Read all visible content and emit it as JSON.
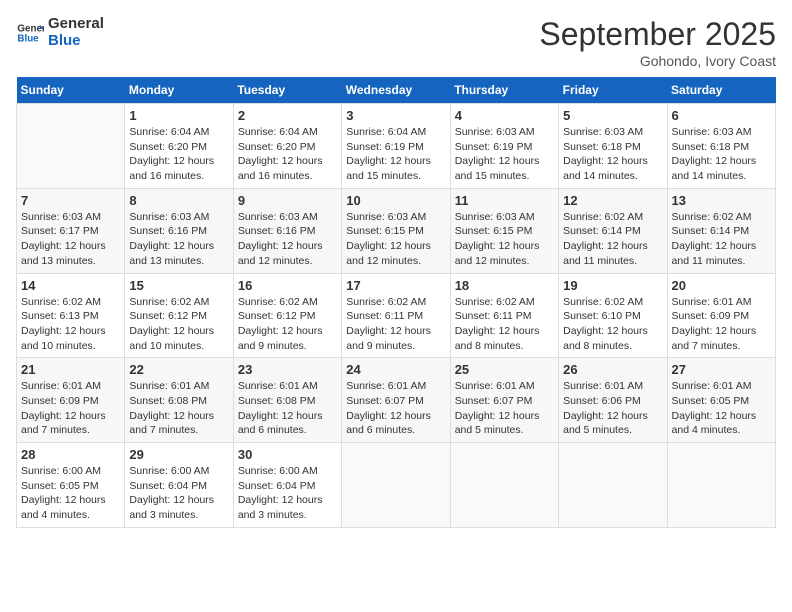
{
  "header": {
    "logo_line1": "General",
    "logo_line2": "Blue",
    "month": "September 2025",
    "location": "Gohondo, Ivory Coast"
  },
  "days_of_week": [
    "Sunday",
    "Monday",
    "Tuesday",
    "Wednesday",
    "Thursday",
    "Friday",
    "Saturday"
  ],
  "weeks": [
    [
      {
        "num": "",
        "info": ""
      },
      {
        "num": "1",
        "info": "Sunrise: 6:04 AM\nSunset: 6:20 PM\nDaylight: 12 hours\nand 16 minutes."
      },
      {
        "num": "2",
        "info": "Sunrise: 6:04 AM\nSunset: 6:20 PM\nDaylight: 12 hours\nand 16 minutes."
      },
      {
        "num": "3",
        "info": "Sunrise: 6:04 AM\nSunset: 6:19 PM\nDaylight: 12 hours\nand 15 minutes."
      },
      {
        "num": "4",
        "info": "Sunrise: 6:03 AM\nSunset: 6:19 PM\nDaylight: 12 hours\nand 15 minutes."
      },
      {
        "num": "5",
        "info": "Sunrise: 6:03 AM\nSunset: 6:18 PM\nDaylight: 12 hours\nand 14 minutes."
      },
      {
        "num": "6",
        "info": "Sunrise: 6:03 AM\nSunset: 6:18 PM\nDaylight: 12 hours\nand 14 minutes."
      }
    ],
    [
      {
        "num": "7",
        "info": "Sunrise: 6:03 AM\nSunset: 6:17 PM\nDaylight: 12 hours\nand 13 minutes."
      },
      {
        "num": "8",
        "info": "Sunrise: 6:03 AM\nSunset: 6:16 PM\nDaylight: 12 hours\nand 13 minutes."
      },
      {
        "num": "9",
        "info": "Sunrise: 6:03 AM\nSunset: 6:16 PM\nDaylight: 12 hours\nand 12 minutes."
      },
      {
        "num": "10",
        "info": "Sunrise: 6:03 AM\nSunset: 6:15 PM\nDaylight: 12 hours\nand 12 minutes."
      },
      {
        "num": "11",
        "info": "Sunrise: 6:03 AM\nSunset: 6:15 PM\nDaylight: 12 hours\nand 12 minutes."
      },
      {
        "num": "12",
        "info": "Sunrise: 6:02 AM\nSunset: 6:14 PM\nDaylight: 12 hours\nand 11 minutes."
      },
      {
        "num": "13",
        "info": "Sunrise: 6:02 AM\nSunset: 6:14 PM\nDaylight: 12 hours\nand 11 minutes."
      }
    ],
    [
      {
        "num": "14",
        "info": "Sunrise: 6:02 AM\nSunset: 6:13 PM\nDaylight: 12 hours\nand 10 minutes."
      },
      {
        "num": "15",
        "info": "Sunrise: 6:02 AM\nSunset: 6:12 PM\nDaylight: 12 hours\nand 10 minutes."
      },
      {
        "num": "16",
        "info": "Sunrise: 6:02 AM\nSunset: 6:12 PM\nDaylight: 12 hours\nand 9 minutes."
      },
      {
        "num": "17",
        "info": "Sunrise: 6:02 AM\nSunset: 6:11 PM\nDaylight: 12 hours\nand 9 minutes."
      },
      {
        "num": "18",
        "info": "Sunrise: 6:02 AM\nSunset: 6:11 PM\nDaylight: 12 hours\nand 8 minutes."
      },
      {
        "num": "19",
        "info": "Sunrise: 6:02 AM\nSunset: 6:10 PM\nDaylight: 12 hours\nand 8 minutes."
      },
      {
        "num": "20",
        "info": "Sunrise: 6:01 AM\nSunset: 6:09 PM\nDaylight: 12 hours\nand 7 minutes."
      }
    ],
    [
      {
        "num": "21",
        "info": "Sunrise: 6:01 AM\nSunset: 6:09 PM\nDaylight: 12 hours\nand 7 minutes."
      },
      {
        "num": "22",
        "info": "Sunrise: 6:01 AM\nSunset: 6:08 PM\nDaylight: 12 hours\nand 7 minutes."
      },
      {
        "num": "23",
        "info": "Sunrise: 6:01 AM\nSunset: 6:08 PM\nDaylight: 12 hours\nand 6 minutes."
      },
      {
        "num": "24",
        "info": "Sunrise: 6:01 AM\nSunset: 6:07 PM\nDaylight: 12 hours\nand 6 minutes."
      },
      {
        "num": "25",
        "info": "Sunrise: 6:01 AM\nSunset: 6:07 PM\nDaylight: 12 hours\nand 5 minutes."
      },
      {
        "num": "26",
        "info": "Sunrise: 6:01 AM\nSunset: 6:06 PM\nDaylight: 12 hours\nand 5 minutes."
      },
      {
        "num": "27",
        "info": "Sunrise: 6:01 AM\nSunset: 6:05 PM\nDaylight: 12 hours\nand 4 minutes."
      }
    ],
    [
      {
        "num": "28",
        "info": "Sunrise: 6:00 AM\nSunset: 6:05 PM\nDaylight: 12 hours\nand 4 minutes."
      },
      {
        "num": "29",
        "info": "Sunrise: 6:00 AM\nSunset: 6:04 PM\nDaylight: 12 hours\nand 3 minutes."
      },
      {
        "num": "30",
        "info": "Sunrise: 6:00 AM\nSunset: 6:04 PM\nDaylight: 12 hours\nand 3 minutes."
      },
      {
        "num": "",
        "info": ""
      },
      {
        "num": "",
        "info": ""
      },
      {
        "num": "",
        "info": ""
      },
      {
        "num": "",
        "info": ""
      }
    ]
  ]
}
